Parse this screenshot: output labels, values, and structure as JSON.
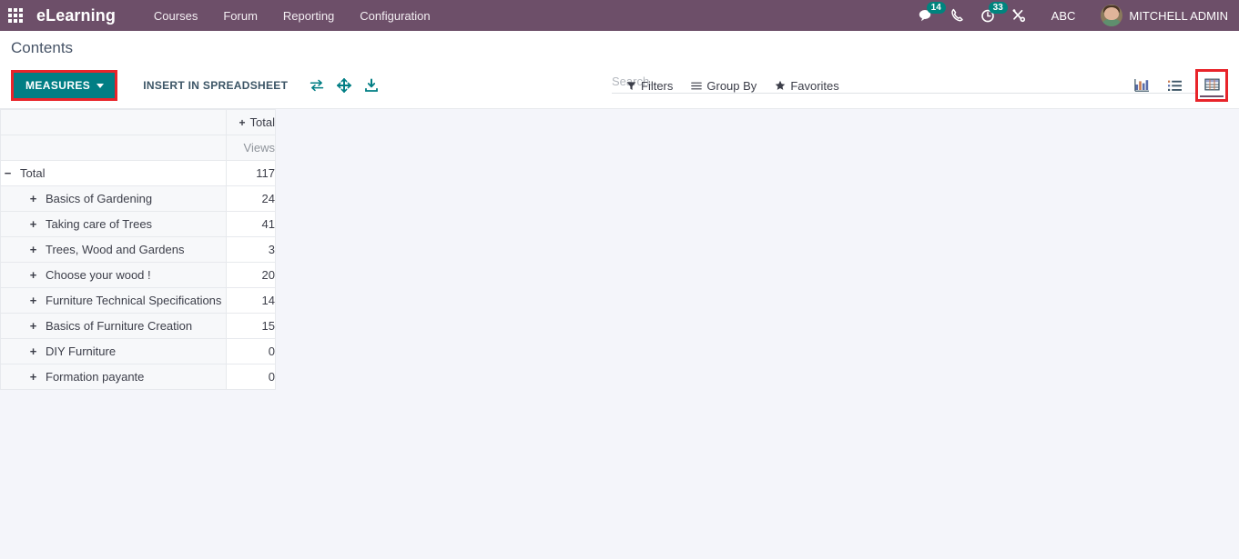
{
  "navbar": {
    "apps_icon": "apps-grid-icon",
    "brand": "eLearning",
    "menu": [
      {
        "label": "Courses"
      },
      {
        "label": "Forum"
      },
      {
        "label": "Reporting"
      },
      {
        "label": "Configuration"
      }
    ],
    "systray": {
      "messages": {
        "icon": "chat-bubble-icon",
        "count": "14"
      },
      "phone": {
        "icon": "phone-icon"
      },
      "activities": {
        "icon": "clock-icon",
        "count": "33"
      },
      "tools": {
        "icon": "tools-icon"
      },
      "debug_label": "ABC",
      "user": {
        "name": "MITCHELL ADMIN",
        "avatar": "user-avatar"
      }
    }
  },
  "control_panel": {
    "breadcrumb": "Contents",
    "measures_label": "MEASURES",
    "insert_spreadsheet_label": "INSERT IN SPREADSHEET",
    "pivot_tools": [
      {
        "name": "flip-axis-icon"
      },
      {
        "name": "expand-all-icon"
      },
      {
        "name": "download-xlsx-icon"
      }
    ],
    "search": {
      "placeholder": "Search...",
      "value": ""
    },
    "filters": [
      {
        "label": "Filters",
        "icon": "funnel-icon"
      },
      {
        "label": "Group By",
        "icon": "list-lines-icon"
      },
      {
        "label": "Favorites",
        "icon": "star-icon"
      }
    ],
    "views": [
      {
        "name": "graph-view",
        "icon": "bar-chart-icon",
        "active": false
      },
      {
        "name": "list-view",
        "icon": "list-view-icon",
        "active": false
      },
      {
        "name": "pivot-view",
        "icon": "pivot-grid-icon",
        "active": true
      }
    ],
    "highlight_color": "#e8242a",
    "accent_color": "#017e84"
  },
  "pivot": {
    "column_header": {
      "label": "Total",
      "toggle": "+"
    },
    "measure_header": "Views",
    "rows": [
      {
        "label": "Total",
        "toggle": "−",
        "level": 0,
        "value": "117"
      },
      {
        "label": "Basics of Gardening",
        "toggle": "+",
        "level": 1,
        "value": "24"
      },
      {
        "label": "Taking care of Trees",
        "toggle": "+",
        "level": 1,
        "value": "41"
      },
      {
        "label": "Trees, Wood and Gardens",
        "toggle": "+",
        "level": 1,
        "value": "3"
      },
      {
        "label": "Choose your wood !",
        "toggle": "+",
        "level": 1,
        "value": "20"
      },
      {
        "label": "Furniture Technical Specifications",
        "toggle": "+",
        "level": 1,
        "value": "14"
      },
      {
        "label": "Basics of Furniture Creation",
        "toggle": "+",
        "level": 1,
        "value": "15"
      },
      {
        "label": "DIY Furniture",
        "toggle": "+",
        "level": 1,
        "value": "0"
      },
      {
        "label": "Formation payante",
        "toggle": "+",
        "level": 1,
        "value": "0"
      }
    ]
  }
}
